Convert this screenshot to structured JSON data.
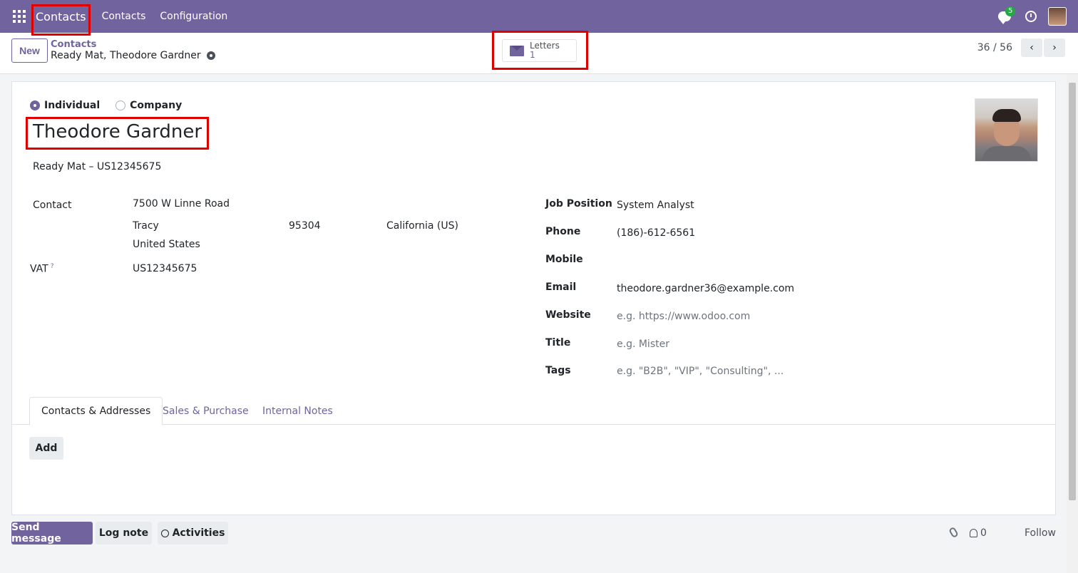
{
  "navbar": {
    "brand": "Contacts",
    "menu": [
      "Contacts",
      "Configuration"
    ],
    "chat_count": "5"
  },
  "control": {
    "new_label": "New",
    "breadcrumb_parent": "Contacts",
    "breadcrumb_current": "Ready Mat, Theodore Gardner",
    "smart_button": {
      "label": "Letters",
      "count": "1"
    },
    "pager": "36 / 56"
  },
  "form": {
    "type_options": [
      "Individual",
      "Company"
    ],
    "selected_type": "Individual",
    "name": "Theodore Gardner",
    "company_line": "Ready Mat – US12345675",
    "left": {
      "contact_label": "Contact",
      "street": "7500 W Linne Road",
      "city": "Tracy",
      "zip": "95304",
      "state": "California (US)",
      "country": "United States",
      "vat_label": "VAT",
      "vat_help": "?",
      "vat": "US12345675"
    },
    "right": [
      {
        "label": "Job Position",
        "value": "System Analyst",
        "placeholder": ""
      },
      {
        "label": "Phone",
        "value": "(186)-612-6561",
        "placeholder": ""
      },
      {
        "label": "Mobile",
        "value": "",
        "placeholder": ""
      },
      {
        "label": "Email",
        "value": "theodore.gardner36@example.com",
        "placeholder": ""
      },
      {
        "label": "Website",
        "value": "",
        "placeholder": "e.g. https://www.odoo.com"
      },
      {
        "label": "Title",
        "value": "",
        "placeholder": "e.g. Mister"
      },
      {
        "label": "Tags",
        "value": "",
        "placeholder": "e.g. \"B2B\", \"VIP\", \"Consulting\", ..."
      }
    ],
    "tabs": [
      "Contacts & Addresses",
      "Sales & Purchase",
      "Internal Notes"
    ],
    "add_label": "Add"
  },
  "chatter": {
    "send_message": "Send message",
    "log_note": "Log note",
    "activities": "Activities",
    "followers_count": "0",
    "follow": "Follow"
  },
  "colors": {
    "brand": "#71639e",
    "highlight": "#e00000"
  }
}
